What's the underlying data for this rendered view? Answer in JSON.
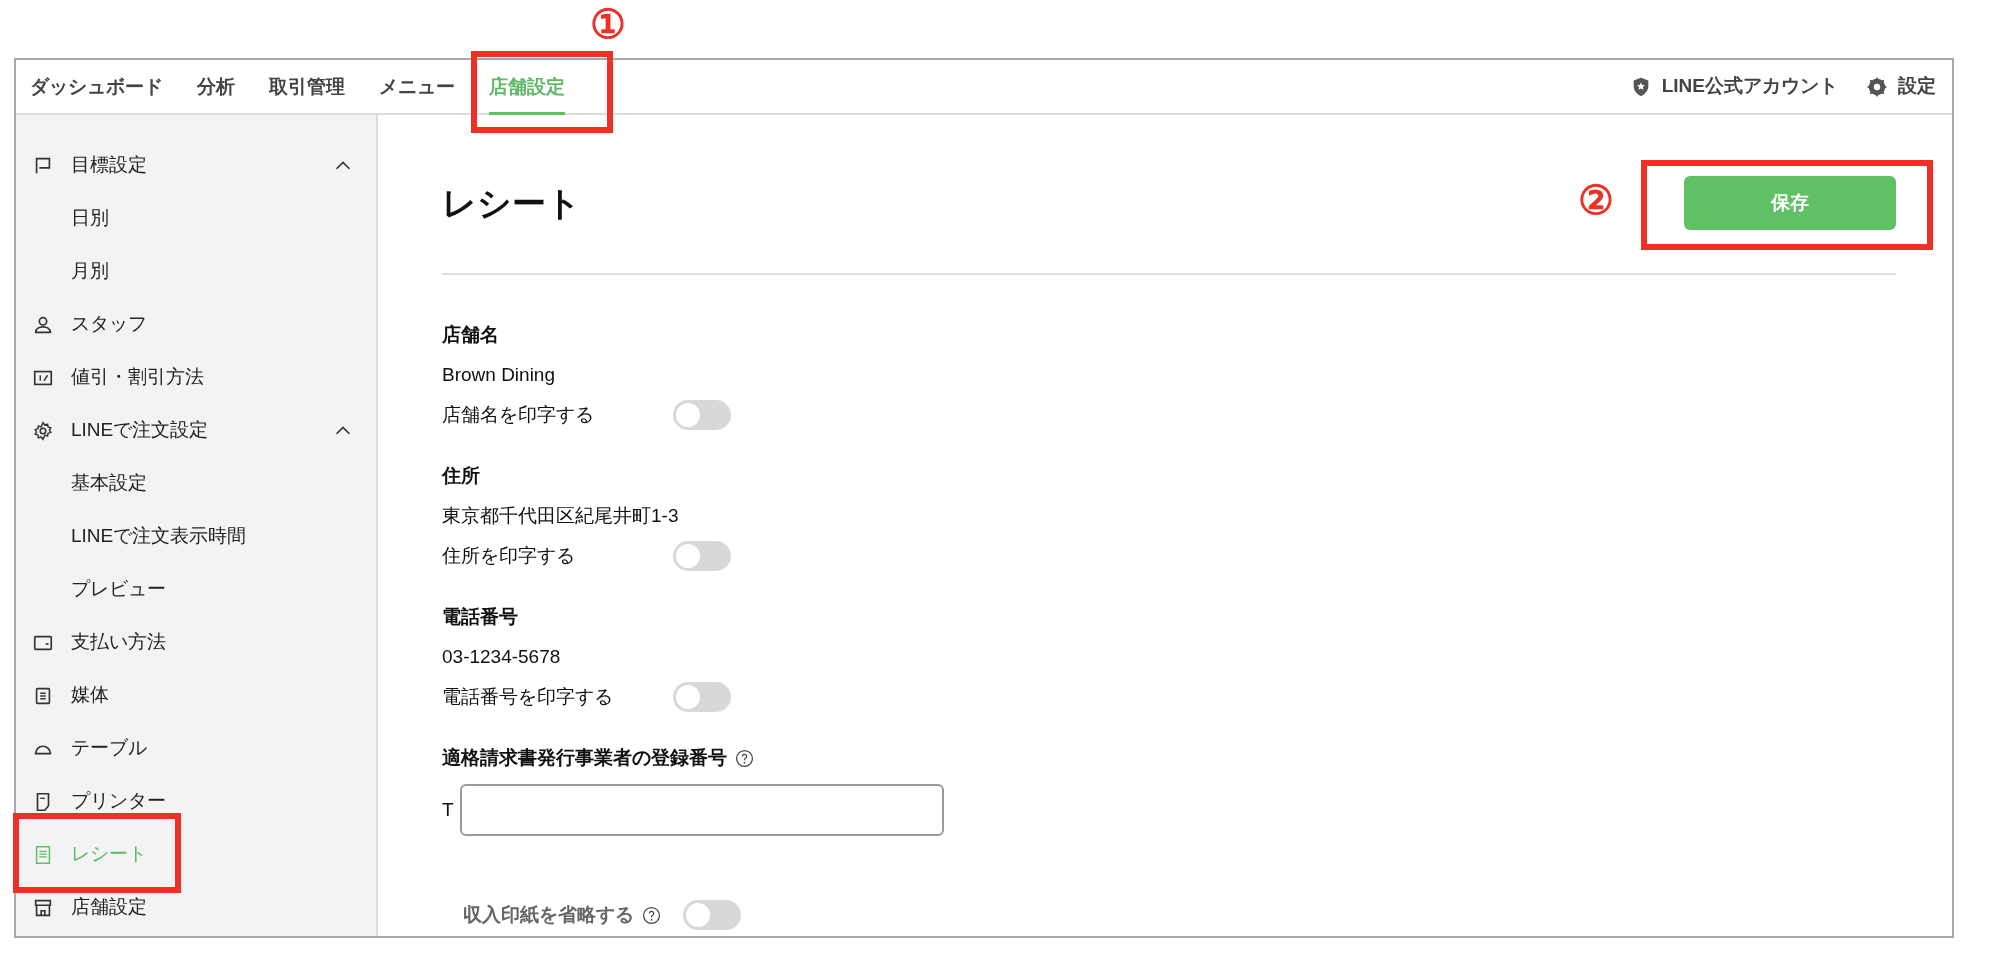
{
  "nav": {
    "tabs": [
      {
        "label": "ダッシュボード",
        "selected": false
      },
      {
        "label": "分析",
        "selected": false
      },
      {
        "label": "取引管理",
        "selected": false
      },
      {
        "label": "メニュー",
        "selected": false
      },
      {
        "label": "店舗設定",
        "selected": true
      }
    ],
    "right": [
      {
        "kind": "account",
        "label": "LINE公式アカウント"
      },
      {
        "kind": "settings",
        "label": "設定"
      }
    ]
  },
  "sidebar": {
    "items": [
      {
        "kind": "flag",
        "label": "目標設定",
        "selected": false,
        "expanded": true,
        "children": [
          {
            "label": "日別",
            "selected": false
          },
          {
            "label": "月別",
            "selected": false
          }
        ]
      },
      {
        "kind": "person",
        "label": "スタッフ",
        "selected": false
      },
      {
        "kind": "discount",
        "label": "値引・割引方法",
        "selected": false
      },
      {
        "kind": "gear",
        "label": "LINEで注文設定",
        "selected": false,
        "expanded": true,
        "children": [
          {
            "label": "基本設定",
            "selected": false
          },
          {
            "label": "LINEで注文表示時間",
            "selected": false
          },
          {
            "label": "プレビュー",
            "selected": false
          }
        ]
      },
      {
        "kind": "wallet",
        "label": "支払い方法",
        "selected": false
      },
      {
        "kind": "document",
        "label": "媒体",
        "selected": false
      },
      {
        "kind": "dome",
        "label": "テーブル",
        "selected": false
      },
      {
        "kind": "printer",
        "label": "プリンター",
        "selected": false
      },
      {
        "kind": "receipt",
        "label": "レシート",
        "selected": true
      },
      {
        "kind": "store",
        "label": "店舗設定",
        "selected": false
      }
    ]
  },
  "page": {
    "title": "レシート",
    "save_button": "保存",
    "sections": [
      {
        "heading": "店舗名",
        "value": "Brown Dining",
        "toggle": {
          "label": "店舗名を印字する",
          "on": false
        }
      },
      {
        "heading": "住所",
        "value": "東京都千代田区紀尾井町1-3",
        "toggle": {
          "label": "住所を印字する",
          "on": false
        }
      },
      {
        "heading": "電話番号",
        "value": "03-1234-5678",
        "toggle": {
          "label": "電話番号を印字する",
          "on": false
        }
      }
    ],
    "invoice": {
      "heading": "適格請求書発行事業者の登録番号",
      "prefix": "T"
    },
    "stamp": {
      "label": "収入印紙を省略する",
      "on": false
    }
  },
  "annotations": [
    {
      "kind": "tab",
      "number": "①"
    },
    {
      "kind": "save",
      "number": "②"
    },
    {
      "kind": "sidebar"
    }
  ]
}
